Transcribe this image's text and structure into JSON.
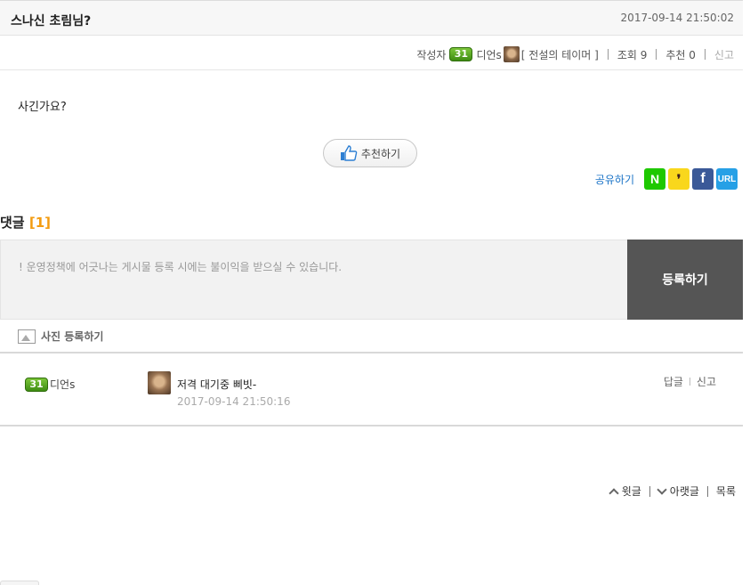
{
  "post": {
    "title": "스나신 초림님?",
    "datetime": "2017-09-14 21:50:02",
    "author_label": "작성자",
    "author_level": "31",
    "author_name": "디언s",
    "author_title": "[ 전설의 테이머 ]",
    "views": "조회 9",
    "recommends": "추천 0",
    "report": "신고",
    "body": "사긴가요?",
    "recommend_button": "추천하기"
  },
  "share": {
    "label": "공유하기",
    "naver": "N",
    "kakao": "❜",
    "facebook": "f",
    "url": "URL"
  },
  "comments": {
    "header": "댓글",
    "count": "[1]",
    "placeholder": "! 운영정책에 어긋나는 게시물 등록 시에는 불이익을 받으실 수 있습니다.",
    "submit": "등록하기",
    "photo_label": "사진 등록하기",
    "items": [
      {
        "level": "31",
        "author": "디언s",
        "text": "저격 대기중 삐빗-",
        "datetime": "2017-09-14 21:50:16",
        "reply": "답글",
        "report": "신고"
      }
    ]
  },
  "nav": {
    "prev": "윗글",
    "next": "아랫글",
    "list": "목록"
  },
  "colors": {
    "accent_count": "#f39c12",
    "level_badge": "#4f9e1e",
    "submit_bg": "#555555",
    "share_label": "#1a73c7"
  }
}
